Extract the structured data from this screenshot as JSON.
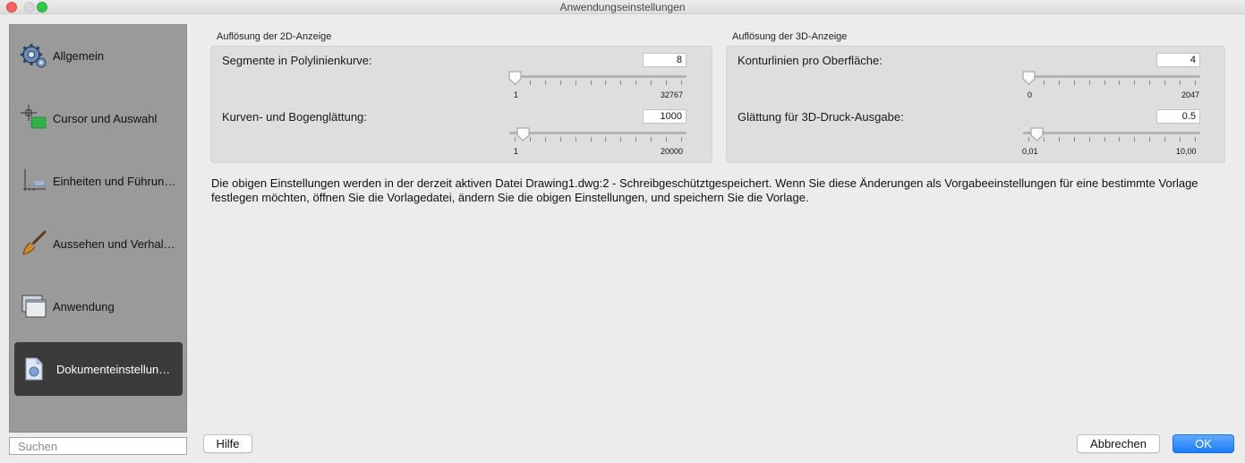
{
  "window": {
    "title": "Anwendungseinstellungen"
  },
  "sidebar": {
    "items": [
      {
        "label": "Allgemein",
        "icon": "gear-icon"
      },
      {
        "label": "Cursor und Auswahl",
        "icon": "crosshair-selection-icon"
      },
      {
        "label": "Einheiten und Führun…",
        "icon": "units-axis-icon"
      },
      {
        "label": "Aussehen und Verhal…",
        "icon": "paintbrush-icon"
      },
      {
        "label": "Anwendung",
        "icon": "windows-icon"
      },
      {
        "label": "Dokumenteinstellun…",
        "icon": "document-icon",
        "selected": true
      }
    ],
    "search_placeholder": "Suchen"
  },
  "resolution_2d": {
    "title": "Auflösung der 2D-Anzeige",
    "settings": [
      {
        "label": "Segmente in Polylinienkurve:",
        "value": "8",
        "min": "1",
        "max": "32767",
        "position": 0.0
      },
      {
        "label": "Kurven- und Bogenglättung:",
        "value": "1000",
        "min": "1",
        "max": "20000",
        "position": 0.05
      }
    ]
  },
  "resolution_3d": {
    "title": "Auflösung der 3D-Anzeige",
    "settings": [
      {
        "label": "Konturlinien pro Oberfläche:",
        "value": "4",
        "min": "0",
        "max": "2047",
        "position": 0.0
      },
      {
        "label": "Glättung für 3D-Druck-Ausgabe:",
        "value": "0.5",
        "min": "0,01",
        "max": "10,00",
        "position": 0.05
      }
    ]
  },
  "description": "Die obigen Einstellungen werden in der derzeit aktiven Datei Drawing1.dwg:2 - Schreibgeschütztgespeichert. Wenn Sie diese Änderungen als Vorgabeeinstellungen für eine bestimmte Vorlage festlegen möchten, öffnen Sie die Vorlagedatei, ändern Sie die obigen Einstellungen, und speichern Sie die Vorlage.",
  "buttons": {
    "help": "Hilfe",
    "cancel": "Abbrechen",
    "ok": "OK"
  },
  "colors": {
    "accent": "#1a7cf7",
    "sidebar_bg": "#9a9a9a",
    "selected_bg": "#3b3b3b",
    "group_bg": "#dedede"
  }
}
